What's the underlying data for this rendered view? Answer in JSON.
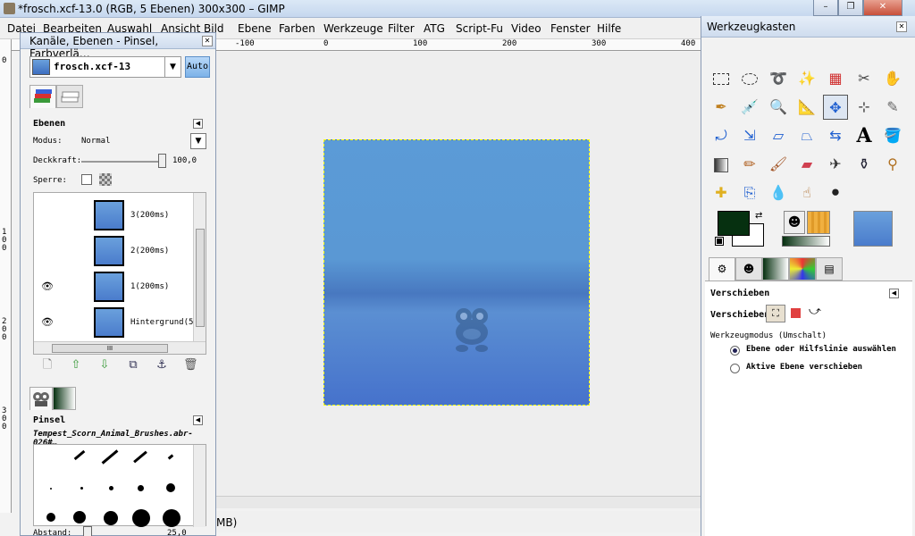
{
  "window": {
    "title": "*frosch.xcf-13.0 (RGB, 5 Ebenen) 300x300 – GIMP",
    "minimize": "–",
    "maximize": "❐",
    "close": "✕"
  },
  "menubar": {
    "items": [
      "Datei",
      "Bearbeiten",
      "Auswahl",
      "Ansicht",
      "Bild",
      "Ebene",
      "Farben",
      "Werkzeuge",
      "Filter",
      "ATG",
      "Script-Fu",
      "Video",
      "Fenster",
      "Hilfe"
    ]
  },
  "ruler": {
    "h_labels": [
      "-100",
      "0",
      "100",
      "200",
      "300",
      "400"
    ],
    "v_labels": [
      "0",
      "1 0 0",
      "2 0 0",
      "3 0 0"
    ]
  },
  "status": {
    "text": "MB)"
  },
  "left_dock": {
    "title": "Kanäle, Ebenen - Pinsel, Farbverlä…",
    "close": "✕",
    "image_name": "frosch.xcf-13",
    "auto_label": "Auto",
    "layers_panel": {
      "title": "Ebenen",
      "mode_label": "Modus:",
      "mode_value": "Normal",
      "opacity_label": "Deckkraft:",
      "opacity_value": "100,0",
      "opacity": 1.0,
      "lock_label": "Sperre:",
      "layers": [
        {
          "name": "3(200ms)",
          "visible": false
        },
        {
          "name": "2(200ms)",
          "visible": false
        },
        {
          "name": "1(200ms)",
          "visible": true
        },
        {
          "name": "Hintergrund(5",
          "visible": true
        }
      ],
      "hscroll_grip": "III"
    },
    "brushes_panel": {
      "title": "Pinsel",
      "brush_name": "Tempest_Scorn_Animal_Brushes.abr-026#…",
      "spacing_label": "Abstand:",
      "spacing_value": "25,0"
    }
  },
  "toolbox": {
    "title": "Werkzeugkasten",
    "close": "✕",
    "options": {
      "title": "Verschieben",
      "move_label": "Verschieben:",
      "mode_title": "Werkzeugmodus (Umschalt)",
      "radio1": "Ebene oder Hilfslinie auswählen",
      "radio2": "Aktive Ebene verschieben"
    }
  }
}
